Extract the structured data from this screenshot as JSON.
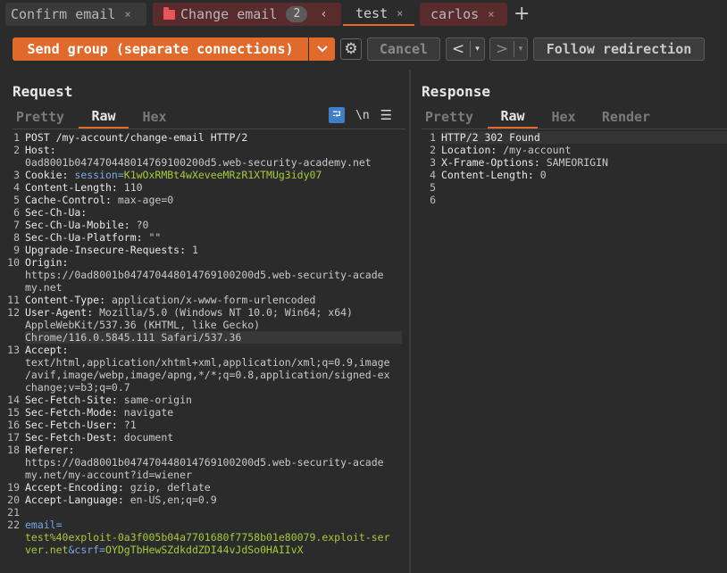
{
  "tabs": [
    {
      "label": "Confirm email",
      "close": "×"
    },
    {
      "label": "Change email",
      "count": "2",
      "chevron": "‹",
      "folder_color": "#e8545a"
    },
    {
      "label": "test",
      "close": "×",
      "active": true
    },
    {
      "label": "carlos",
      "close": "×"
    }
  ],
  "toolbar": {
    "send_label": "Send group (separate connections)",
    "cancel_label": "Cancel",
    "follow_label": "Follow redirection",
    "back_glyph": "<",
    "fwd_glyph": ">",
    "dd_glyph": "▾",
    "plus": "+",
    "accent_color": "#e06a2c"
  },
  "request": {
    "title": "Request",
    "subtabs": [
      "Pretty",
      "Raw",
      "Hex"
    ],
    "active_subtab": "Raw",
    "icons": {
      "wrap": "wrap-lines-icon",
      "newline": "\\n",
      "menu": "menu-icon"
    }
  },
  "response": {
    "title": "Response",
    "subtabs": [
      "Pretty",
      "Raw",
      "Hex",
      "Render"
    ],
    "active_subtab": "Raw"
  },
  "request_lines": [
    {
      "n": "1",
      "h": "POST /my-account/change-email HTTP/2",
      "v": ""
    },
    {
      "n": "2",
      "h": "Host:",
      "v": ""
    },
    {
      "n": "",
      "h": "",
      "v": "0ad8001b047470448014769100200d5.web-security-academy.net"
    },
    {
      "n": "3",
      "h": "Cookie: ",
      "v": "",
      "p": "session=",
      "pv": "K1wOxRMBt4wXeveeMRzR1XTMUg3idy07"
    },
    {
      "n": "4",
      "h": "Content-Length:",
      "v": " 110"
    },
    {
      "n": "5",
      "h": "Cache-Control:",
      "v": " max-age=0"
    },
    {
      "n": "6",
      "h": "Sec-Ch-Ua:",
      "v": ""
    },
    {
      "n": "7",
      "h": "Sec-Ch-Ua-Mobile:",
      "v": " ?0"
    },
    {
      "n": "8",
      "h": "Sec-Ch-Ua-Platform:",
      "v": " \"\""
    },
    {
      "n": "9",
      "h": "Upgrade-Insecure-Requests:",
      "v": " 1"
    },
    {
      "n": "10",
      "h": "Origin:",
      "v": ""
    },
    {
      "n": "",
      "h": "",
      "v": "https://0ad8001b047470448014769100200d5.web-security-acade"
    },
    {
      "n": "",
      "h": "",
      "v": "my.net"
    },
    {
      "n": "11",
      "h": "Content-Type:",
      "v": " application/x-www-form-urlencoded"
    },
    {
      "n": "12",
      "h": "User-Agent:",
      "v": " Mozilla/5.0 (Windows NT 10.0; Win64; x64)"
    },
    {
      "n": "",
      "h": "",
      "v": "AppleWebKit/537.36 (KHTML, like Gecko)"
    },
    {
      "n": "",
      "h": "",
      "v": "Chrome/116.0.5845.111 Safari/537.36",
      "hl": true
    },
    {
      "n": "13",
      "h": "Accept:",
      "v": ""
    },
    {
      "n": "",
      "h": "",
      "v": "text/html,application/xhtml+xml,application/xml;q=0.9,image"
    },
    {
      "n": "",
      "h": "",
      "v": "/avif,image/webp,image/apng,*/*;q=0.8,application/signed-ex"
    },
    {
      "n": "",
      "h": "",
      "v": "change;v=b3;q=0.7"
    },
    {
      "n": "14",
      "h": "Sec-Fetch-Site:",
      "v": " same-origin"
    },
    {
      "n": "15",
      "h": "Sec-Fetch-Mode:",
      "v": " navigate"
    },
    {
      "n": "16",
      "h": "Sec-Fetch-User:",
      "v": " ?1"
    },
    {
      "n": "17",
      "h": "Sec-Fetch-Dest:",
      "v": " document"
    },
    {
      "n": "18",
      "h": "Referer:",
      "v": ""
    },
    {
      "n": "",
      "h": "",
      "v": "https://0ad8001b047470448014769100200d5.web-security-acade"
    },
    {
      "n": "",
      "h": "",
      "v": "my.net/my-account?id=wiener"
    },
    {
      "n": "19",
      "h": "Accept-Encoding:",
      "v": " gzip, deflate"
    },
    {
      "n": "20",
      "h": "Accept-Language:",
      "v": " en-US,en;q=0.9"
    },
    {
      "n": "21",
      "h": "",
      "v": ""
    },
    {
      "n": "22",
      "h": "",
      "v": "",
      "p": "email=",
      "pv": ""
    },
    {
      "n": "",
      "h": "",
      "v": "",
      "p": "",
      "pv": "test%40exploit-0a3f005b04a7701680f7758b01e80079.exploit-ser"
    },
    {
      "n": "",
      "h": "",
      "v": "",
      "p": "",
      "pv": "ver.net",
      "p2": "&csrf=",
      "pv2": "OYDgTbHewSZdkddZDI44vJdSo0HAIIvX"
    }
  ],
  "response_lines": [
    {
      "n": "1",
      "h": "HTTP/2 302 Found",
      "v": "",
      "hl": true
    },
    {
      "n": "2",
      "h": "Location:",
      "v": " /my-account"
    },
    {
      "n": "3",
      "h": "X-Frame-Options:",
      "v": " SAMEORIGIN"
    },
    {
      "n": "4",
      "h": "Content-Length:",
      "v": " 0"
    },
    {
      "n": "5",
      "h": "",
      "v": ""
    },
    {
      "n": "6",
      "h": "",
      "v": ""
    }
  ]
}
